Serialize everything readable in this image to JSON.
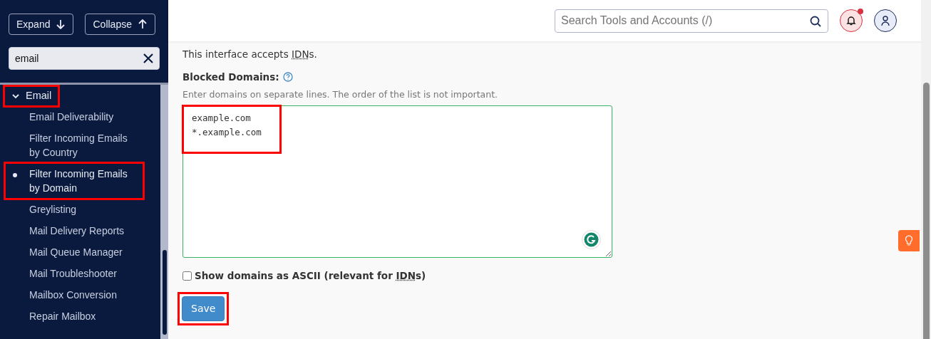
{
  "sidebar": {
    "buttons": [
      {
        "label": "Expand"
      },
      {
        "label": "Collapse"
      }
    ],
    "filter": {
      "value": "email"
    },
    "groups": [
      {
        "label": "Email",
        "expanded": true,
        "highlighted": true,
        "children": [
          {
            "label": "Email Deliverability",
            "selected": false,
            "highlighted": false
          },
          {
            "label": "Filter Incoming Emails by Country",
            "selected": false,
            "highlighted": false
          },
          {
            "label": "Filter Incoming Emails by Domain",
            "selected": true,
            "highlighted": true
          },
          {
            "label": "Greylisting",
            "selected": false,
            "highlighted": false
          },
          {
            "label": "Mail Delivery Reports",
            "selected": false,
            "highlighted": false
          },
          {
            "label": "Mail Queue Manager",
            "selected": false,
            "highlighted": false
          },
          {
            "label": "Mail Troubleshooter",
            "selected": false,
            "highlighted": false
          },
          {
            "label": "Mailbox Conversion",
            "selected": false,
            "highlighted": false
          },
          {
            "label": "Repair Mailbox",
            "selected": false,
            "highlighted": false
          }
        ]
      }
    ]
  },
  "header": {
    "search": {
      "placeholder": "Search Tools and Accounts (/)"
    },
    "notifications": {
      "unread": true
    }
  },
  "content": {
    "intro": {
      "before": "This interface accepts ",
      "abbr": "IDN",
      "after": "s."
    },
    "blocked": {
      "label": "Blocked Domains:",
      "hint": "Enter domains on separate lines. The order of the list is not important.",
      "value": "example.com\n*.example.com",
      "highlighted": true
    },
    "ascii": {
      "before": "Show domains as ASCII (relevant for ",
      "abbr": "IDN",
      "after": "s)",
      "checked": false
    },
    "save": {
      "label": "Save",
      "highlighted": true
    }
  }
}
